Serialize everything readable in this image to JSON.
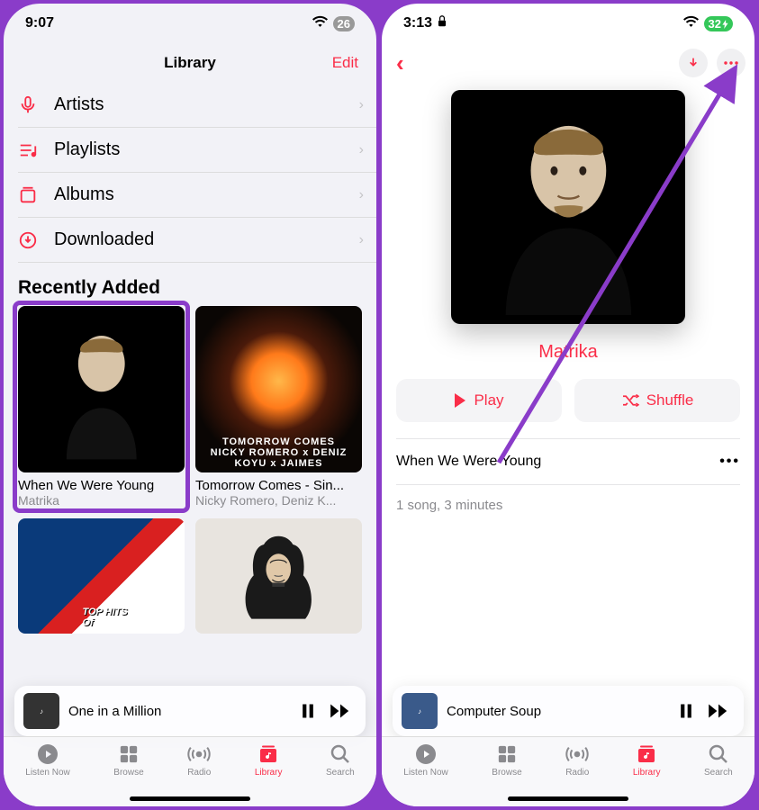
{
  "left": {
    "status": {
      "time": "9:07",
      "battery": "26"
    },
    "header": {
      "title": "Library",
      "edit": "Edit"
    },
    "menu": [
      {
        "icon": "mic-icon",
        "label": "Artists"
      },
      {
        "icon": "playlist-icon",
        "label": "Playlists"
      },
      {
        "icon": "album-icon",
        "label": "Albums"
      },
      {
        "icon": "download-icon",
        "label": "Downloaded"
      }
    ],
    "section": "Recently Added",
    "cards": [
      {
        "title": "When We Were Young",
        "subtitle": "Matrika",
        "art": "portrait-man-black",
        "highlight": true
      },
      {
        "title": "Tomorrow Comes - Sin...",
        "subtitle": "Nicky Romero, Deniz K...",
        "art": "tomorrow-comes-ring",
        "art_text": "TOMORROW COMES\nNICKY ROMERO x DENIZ KOYU x JAIMES"
      },
      {
        "title": "",
        "subtitle": "",
        "art": "top-hits",
        "art_text": "TOP HITS\nOf"
      },
      {
        "title": "",
        "subtitle": "",
        "art": "hooded-man"
      }
    ],
    "nowplaying": {
      "title": "One in a Million"
    },
    "tabs": [
      {
        "label": "Listen Now",
        "icon": "play-circle-icon"
      },
      {
        "label": "Browse",
        "icon": "grid-icon"
      },
      {
        "label": "Radio",
        "icon": "radio-icon"
      },
      {
        "label": "Library",
        "icon": "library-icon",
        "active": true
      },
      {
        "label": "Search",
        "icon": "search-icon"
      }
    ]
  },
  "right": {
    "status": {
      "time": "3:13",
      "battery": "32"
    },
    "artist": "Matrika",
    "buttons": {
      "play": "Play",
      "shuffle": "Shuffle"
    },
    "track": {
      "name": "When We Were Young"
    },
    "meta": "1 song, 3 minutes",
    "nowplaying": {
      "title": "Computer Soup"
    },
    "tabs": [
      {
        "label": "Listen Now",
        "icon": "play-circle-icon"
      },
      {
        "label": "Browse",
        "icon": "grid-icon"
      },
      {
        "label": "Radio",
        "icon": "radio-icon"
      },
      {
        "label": "Library",
        "icon": "library-icon",
        "active": true
      },
      {
        "label": "Search",
        "icon": "search-icon"
      }
    ]
  },
  "colors": {
    "accent": "#fa2d48",
    "annotation": "#8a3cc9"
  }
}
